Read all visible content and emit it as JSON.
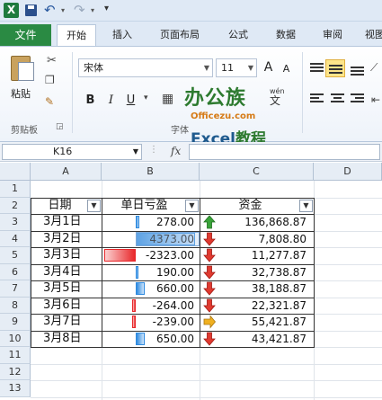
{
  "app": {
    "icon_letter": "X"
  },
  "tabs": {
    "file": "文件",
    "items": [
      "开始",
      "插入",
      "页面布局",
      "公式",
      "数据",
      "审阅",
      "视图"
    ]
  },
  "ribbon": {
    "paste_label": "粘贴",
    "clipboard_label": "剪贴板",
    "font_group_label": "字体",
    "font_name": "宋体",
    "font_size": "11",
    "grow_font": "A",
    "shrink_font": "A",
    "bold": "B",
    "italic": "I",
    "underline": "U",
    "wen": "wén",
    "wen_char": "文"
  },
  "watermark": {
    "brand": "办公族",
    "site": "Officezu.com",
    "excel": "Excel",
    "suffix": "教程"
  },
  "formula_bar": {
    "name_box": "K16",
    "fx": "fx",
    "formula": ""
  },
  "grid": {
    "columns": [
      "A",
      "B",
      "C",
      "D"
    ],
    "rows": [
      "1",
      "2",
      "3",
      "4",
      "5",
      "6",
      "7",
      "8",
      "9",
      "10",
      "11",
      "12",
      "13"
    ],
    "headers": {
      "date": "日期",
      "daily_pl": "单日亏盈",
      "funds": "资金"
    },
    "data": [
      {
        "date": "3月1日",
        "pl": "278.00",
        "pl_value": 278,
        "funds": "136,868.87",
        "trend": "up"
      },
      {
        "date": "3月2日",
        "pl": "4373.00",
        "pl_value": 4373,
        "funds": "7,808.80",
        "trend": "down"
      },
      {
        "date": "3月3日",
        "pl": "-2323.00",
        "pl_value": -2323,
        "funds": "11,277.87",
        "trend": "down"
      },
      {
        "date": "3月4日",
        "pl": "190.00",
        "pl_value": 190,
        "funds": "32,738.87",
        "trend": "down"
      },
      {
        "date": "3月5日",
        "pl": "660.00",
        "pl_value": 660,
        "funds": "38,188.87",
        "trend": "down"
      },
      {
        "date": "3月6日",
        "pl": "-264.00",
        "pl_value": -264,
        "funds": "22,321.87",
        "trend": "down"
      },
      {
        "date": "3月7日",
        "pl": "-239.00",
        "pl_value": -239,
        "funds": "55,421.87",
        "trend": "right"
      },
      {
        "date": "3月8日",
        "pl": "650.00",
        "pl_value": 650,
        "funds": "43,421.87",
        "trend": "down"
      }
    ]
  },
  "colors": {
    "positive_bar": "#2f8be0",
    "negative_bar": "#e8282b",
    "up_arrow": "#3aa33a",
    "down_arrow": "#e03a30",
    "side_arrow": "#f0b020"
  }
}
